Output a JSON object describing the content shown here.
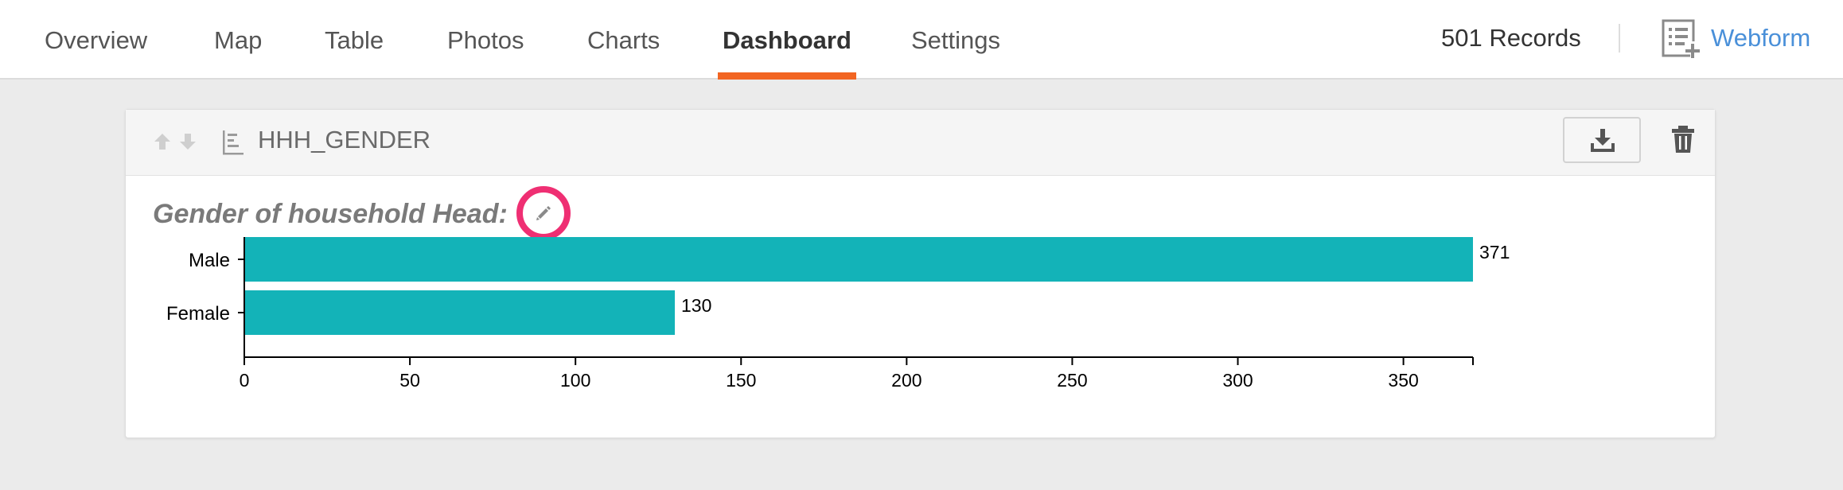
{
  "nav": {
    "tabs": [
      {
        "label": "Overview"
      },
      {
        "label": "Map"
      },
      {
        "label": "Table"
      },
      {
        "label": "Photos"
      },
      {
        "label": "Charts"
      },
      {
        "label": "Dashboard",
        "active": true
      },
      {
        "label": "Settings"
      }
    ],
    "records": "501 Records",
    "webform_label": "Webform",
    "accent_color": "#f26522",
    "link_color": "#4a90d9"
  },
  "widget": {
    "field_name": "HHH_GENDER",
    "icons": {
      "move_up": "arrow-up-icon",
      "move_down": "arrow-down-icon",
      "field_type": "bar-chart-icon",
      "download": "download-icon",
      "delete": "trash-icon",
      "edit": "pencil-icon"
    },
    "title": "Gender of household Head:"
  },
  "chart_data": {
    "type": "bar",
    "orientation": "horizontal",
    "categories": [
      "Male",
      "Female"
    ],
    "values": [
      371,
      130
    ],
    "xlim": [
      0,
      371
    ],
    "x_ticks": [
      0,
      50,
      100,
      150,
      200,
      250,
      300,
      350
    ],
    "bar_color": "#13b3b8",
    "grid": false
  }
}
